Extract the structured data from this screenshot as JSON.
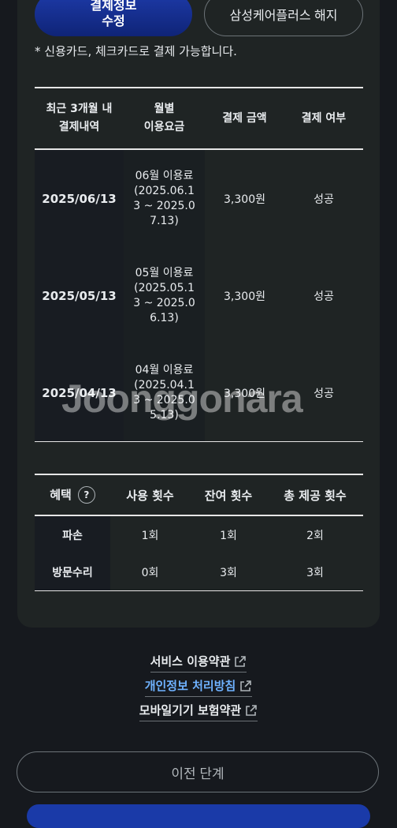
{
  "buttons": {
    "edit_payment": "결제정보\n수정",
    "cancel_service": "삼성케어플러스 해지",
    "prev": "이전 단계"
  },
  "note": "* 신용카드, 체크카드로 결제 가능합니다.",
  "payment_table": {
    "headers": [
      "최근 3개월 내\n결제내역",
      "월별\n이용요금",
      "결제 금액",
      "결제 여부"
    ],
    "rows": [
      {
        "date": "2025/06/13",
        "fee": "06월 이용료\n(2025.06.1\n3 ~ 2025.0\n7.13)",
        "amount": "3,300원",
        "status": "성공"
      },
      {
        "date": "2025/05/13",
        "fee": "05월 이용료\n(2025.05.1\n3 ~ 2025.0\n6.13)",
        "amount": "3,300원",
        "status": "성공"
      },
      {
        "date": "2025/04/13",
        "fee": "04월 이용료\n(2025.04.1\n3 ~ 2025.0\n5.13)",
        "amount": "3,300원",
        "status": "성공"
      }
    ]
  },
  "benefit_table": {
    "headers": [
      "혜택",
      "사용 횟수",
      "잔여 횟수",
      "총 제공 횟수"
    ],
    "help_glyph": "?",
    "rows": [
      {
        "label": "파손",
        "used": "1회",
        "remaining": "1회",
        "total": "2회"
      },
      {
        "label": "방문수리",
        "used": "0회",
        "remaining": "3회",
        "total": "3회"
      }
    ]
  },
  "links": [
    "서비스 이용약관",
    "개인정보 처리방침",
    "모바일기기 보험약관"
  ],
  "watermark": "Joonggonara",
  "colors": {
    "primary": "#1a3aa8",
    "link_blue": "#6fb2ff",
    "background": "#16191e"
  }
}
